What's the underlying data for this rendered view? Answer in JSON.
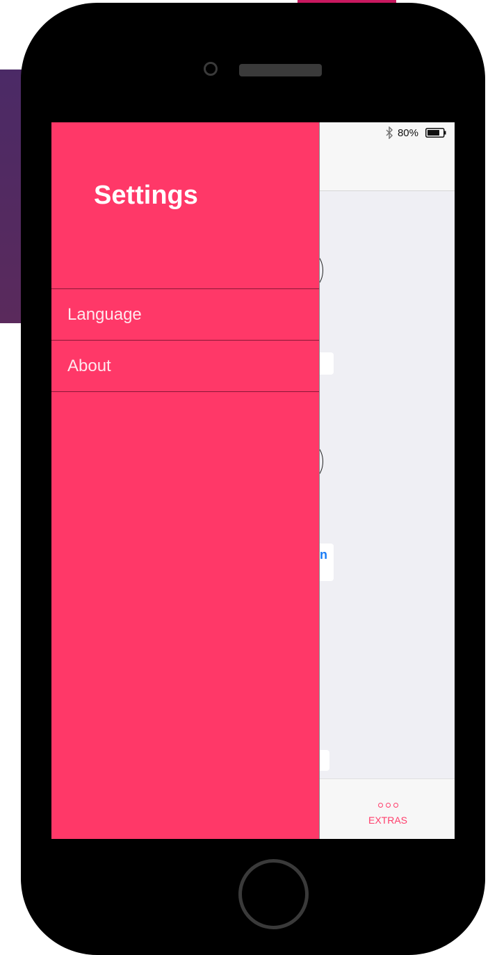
{
  "status": {
    "battery_percent": "80%",
    "bluetooth_icon": "bluetooth-icon",
    "battery_icon": "battery-icon"
  },
  "drawer": {
    "title": "Settings",
    "items": [
      {
        "label": "Language"
      },
      {
        "label": "About"
      }
    ],
    "background_color": "#ff3868"
  },
  "content": {
    "partial_button_text": "n"
  },
  "tab_bar": {
    "extras_label": "EXTRAS",
    "extras_icon": "more-dots-icon",
    "accent_color": "#ff3d6b"
  }
}
